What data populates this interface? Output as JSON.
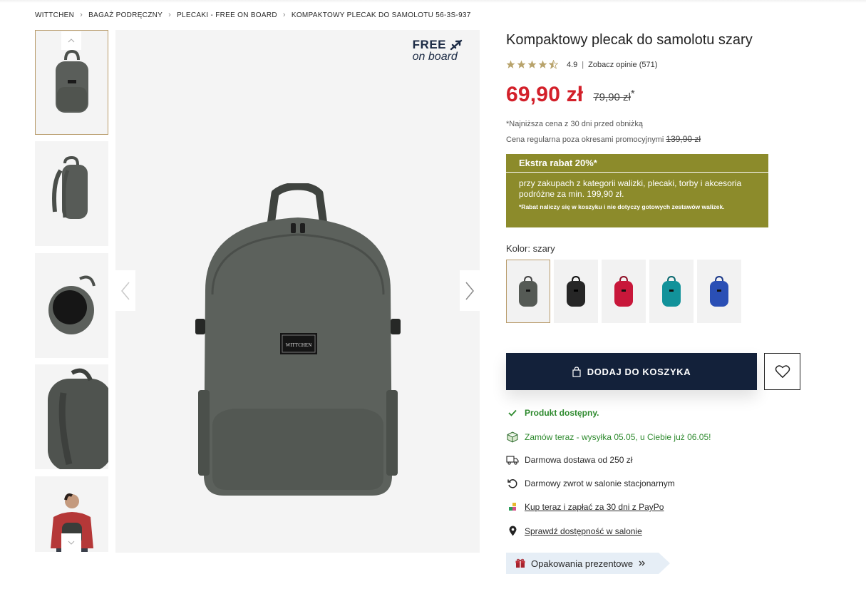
{
  "breadcrumb": [
    "WITTCHEN",
    "BAGAŻ PODRĘCZNY",
    "PLECAKI - FREE ON BOARD",
    "KOMPAKTOWY PLECAK DO SAMOLOTU 56-3S-937"
  ],
  "badge": {
    "line1": "FREE",
    "line2": "on board"
  },
  "product": {
    "title": "Kompaktowy plecak do samolotu szary",
    "rating_value": "4.9",
    "rating_stars": 4.5,
    "reviews_link": "Zobacz opinie (571)",
    "price_now": "69,90 zł",
    "price_old": "79,90 zł",
    "price_old_mark": "*",
    "lowest_note": "*Najniższa cena z 30 dni przed obniżką",
    "regular_label": "Cena regularna poza okresami promocyjnymi",
    "regular_price": "139,90 zł"
  },
  "promo": {
    "title": "Ekstra rabat 20%*",
    "body": "przy zakupach z kategorii walizki, plecaki, torby i akcesoria podróżne za min. 199,90 zł.",
    "note": "*Rabat naliczy się w koszyku i nie dotyczy gotowych zestawów walizek.",
    "color": "#8c8b2b"
  },
  "color_label": "Kolor: szary",
  "swatches": [
    {
      "name": "szary",
      "color": "#555a55"
    },
    {
      "name": "czarny",
      "color": "#262626"
    },
    {
      "name": "czerwony",
      "color": "#c8173a"
    },
    {
      "name": "turkusowy",
      "color": "#12929a"
    },
    {
      "name": "niebieski",
      "color": "#2a4fb5"
    }
  ],
  "add_to_cart": "DODAJ DO KOSZYKA",
  "features": {
    "available": "Produkt dostępny.",
    "shipping": "Zamów teraz - wysyłka 05.05, u Ciebie już 06.05!",
    "free_delivery": "Darmowa dostawa od 250 zł",
    "free_return": "Darmowy zwrot w salonie stacjonarnym",
    "paypo": "Kup teraz i zapłać za 30 dni z PayPo",
    "store": "Sprawdź dostępność w salonie"
  },
  "gift": "Opakowania prezentowe",
  "colors": {
    "accent": "#13213a",
    "price": "#d3202a",
    "available": "#2e8a2e",
    "star": "#b8a36b"
  }
}
